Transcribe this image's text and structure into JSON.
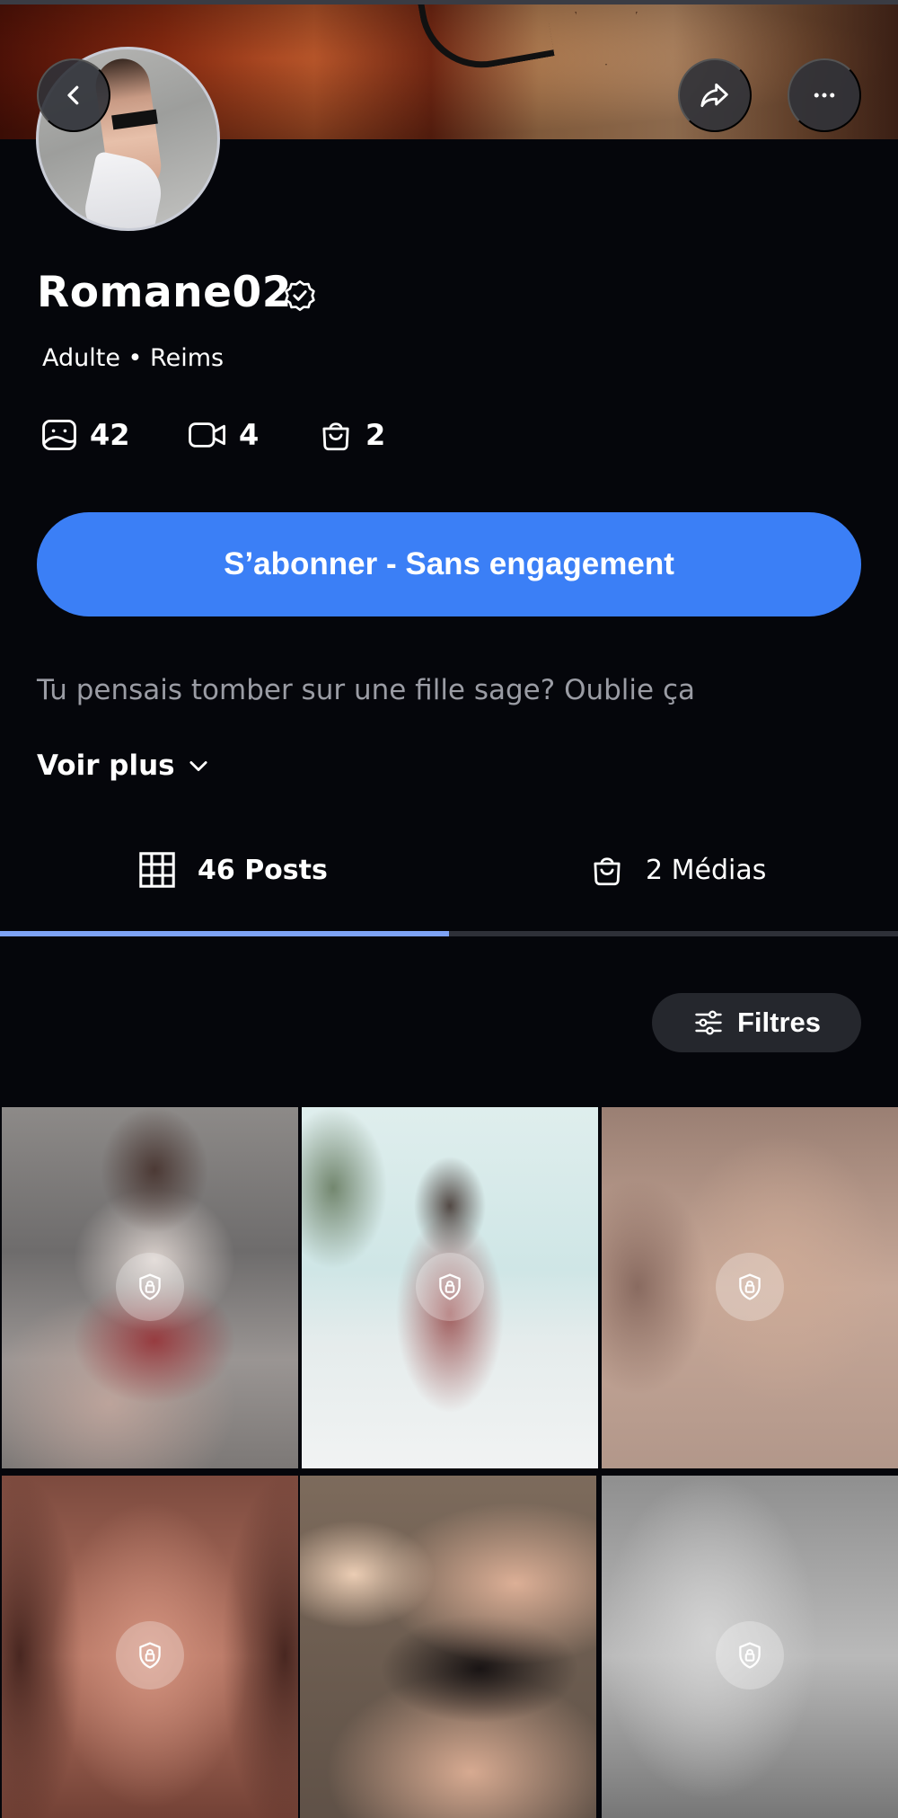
{
  "profile": {
    "name": "Romane02",
    "meta": "Adulte • Reims",
    "bio": "Tu pensais tomber sur une fille sage? Oublie ça",
    "see_more": "Voir plus"
  },
  "stats": {
    "photos": "42",
    "videos": "4",
    "shop": "2"
  },
  "subscribe_label": "S’abonner - Sans engagement",
  "tabs": {
    "posts": "46 Posts",
    "medias": "2 Médias",
    "active": "posts"
  },
  "filter_label": "Filtres",
  "icons": {
    "back": "chevron-left-icon",
    "share": "share-icon",
    "more": "more-icon",
    "verified": "verified-badge-icon",
    "photos": "photo-icon",
    "videos": "video-icon",
    "shop": "shopping-bag-icon",
    "grid": "grid-icon",
    "filter": "sliders-icon",
    "lock": "lock-shield-icon"
  },
  "colors": {
    "background": "#05060b",
    "accent": "#3b7ff6",
    "tab_indicator": "#7da2f5",
    "muted_text": "#9a9ca4"
  },
  "grid": {
    "tiles": [
      {
        "locked": true
      },
      {
        "locked": true
      },
      {
        "locked": true
      },
      {
        "locked": true
      },
      {
        "locked": false
      },
      {
        "locked": true
      }
    ]
  }
}
